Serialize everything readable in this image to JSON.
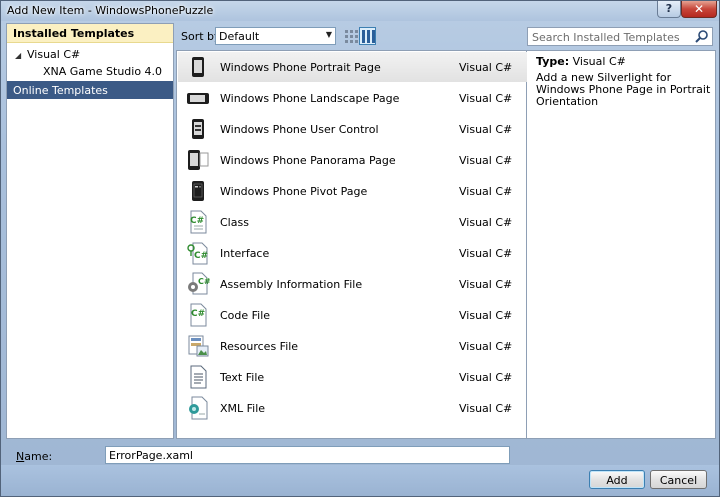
{
  "window": {
    "title": "Add New Item - WindowsPhonePuzzle",
    "help_label": "?",
    "close_label": "✕"
  },
  "left_pane": {
    "header": "Installed Templates",
    "tree": [
      {
        "label": "Visual C#",
        "arrow": "◢"
      },
      {
        "label": "XNA Game Studio 4.0"
      }
    ],
    "online": "Online Templates"
  },
  "toolbar": {
    "sort_label": "Sort by:",
    "sort_value": "Default",
    "search_placeholder": "Search Installed Templates"
  },
  "templates": [
    {
      "name": "Windows Phone Portrait Page",
      "lang": "Visual C#",
      "icon": "phone-portrait-icon"
    },
    {
      "name": "Windows Phone Landscape Page",
      "lang": "Visual C#",
      "icon": "phone-landscape-icon"
    },
    {
      "name": "Windows Phone User Control",
      "lang": "Visual C#",
      "icon": "phone-user-control-icon"
    },
    {
      "name": "Windows Phone Panorama Page",
      "lang": "Visual C#",
      "icon": "phone-panorama-icon"
    },
    {
      "name": "Windows Phone Pivot Page",
      "lang": "Visual C#",
      "icon": "phone-pivot-icon"
    },
    {
      "name": "Class",
      "lang": "Visual C#",
      "icon": "class-file-icon"
    },
    {
      "name": "Interface",
      "lang": "Visual C#",
      "icon": "interface-file-icon"
    },
    {
      "name": "Assembly Information File",
      "lang": "Visual C#",
      "icon": "assembly-info-icon"
    },
    {
      "name": "Code File",
      "lang": "Visual C#",
      "icon": "code-file-icon"
    },
    {
      "name": "Resources File",
      "lang": "Visual C#",
      "icon": "resources-file-icon"
    },
    {
      "name": "Text File",
      "lang": "Visual C#",
      "icon": "text-file-icon"
    },
    {
      "name": "XML File",
      "lang": "Visual C#",
      "icon": "xml-file-icon"
    }
  ],
  "details": {
    "type_key": "Type:",
    "type_value": "Visual C#",
    "description": "Add a new Silverlight for Windows Phone Page in Portrait Orientation"
  },
  "name_field": {
    "label_u": "N",
    "label_rest": "ame:",
    "value": "ErrorPage.xaml"
  },
  "buttons": {
    "add": "Add",
    "cancel": "Cancel"
  },
  "colors": {
    "selection": "#3b5a86",
    "header_bg": "#fbf0c2",
    "csharp_green": "#2e8b2e"
  }
}
